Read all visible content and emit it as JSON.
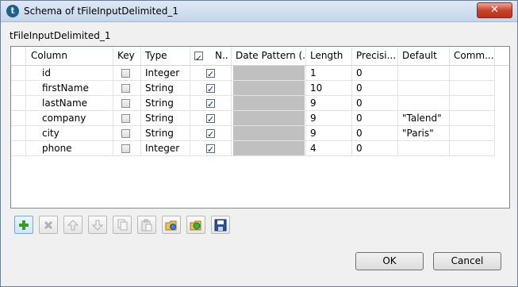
{
  "window": {
    "title": "Schema of tFileInputDelimited_1",
    "close_label": "✕"
  },
  "component_label": "tFileInputDelimited_1",
  "table": {
    "columns": [
      "Column",
      "Key",
      "Type",
      "N..",
      "Date Pattern (...",
      "Length",
      "Precisi...",
      "Default",
      "Comm..."
    ],
    "rows": [
      {
        "column": "id",
        "key": false,
        "type": "Integer",
        "nullable": true,
        "length": "1",
        "precision": "0",
        "default": ""
      },
      {
        "column": "firstName",
        "key": false,
        "type": "String",
        "nullable": true,
        "length": "10",
        "precision": "0",
        "default": ""
      },
      {
        "column": "lastName",
        "key": false,
        "type": "String",
        "nullable": true,
        "length": "9",
        "precision": "0",
        "default": ""
      },
      {
        "column": "company",
        "key": false,
        "type": "String",
        "nullable": true,
        "length": "9",
        "precision": "0",
        "default": "\"Talend\""
      },
      {
        "column": "city",
        "key": false,
        "type": "String",
        "nullable": true,
        "length": "9",
        "precision": "0",
        "default": "\"Paris\""
      },
      {
        "column": "phone",
        "key": false,
        "type": "Integer",
        "nullable": true,
        "length": "4",
        "precision": "0",
        "default": ""
      }
    ]
  },
  "toolbar": {
    "icons": [
      "add-icon",
      "remove-icon",
      "move-up-icon",
      "move-down-icon",
      "copy-icon",
      "paste-icon",
      "import-icon",
      "export-icon",
      "save-icon"
    ]
  },
  "buttons": {
    "ok": "OK",
    "cancel": "Cancel"
  },
  "colors": {
    "accent_green": "#3a9a2a",
    "disabled_cell": "#c0c0c0",
    "checkbox_check": "#1c2a52"
  }
}
